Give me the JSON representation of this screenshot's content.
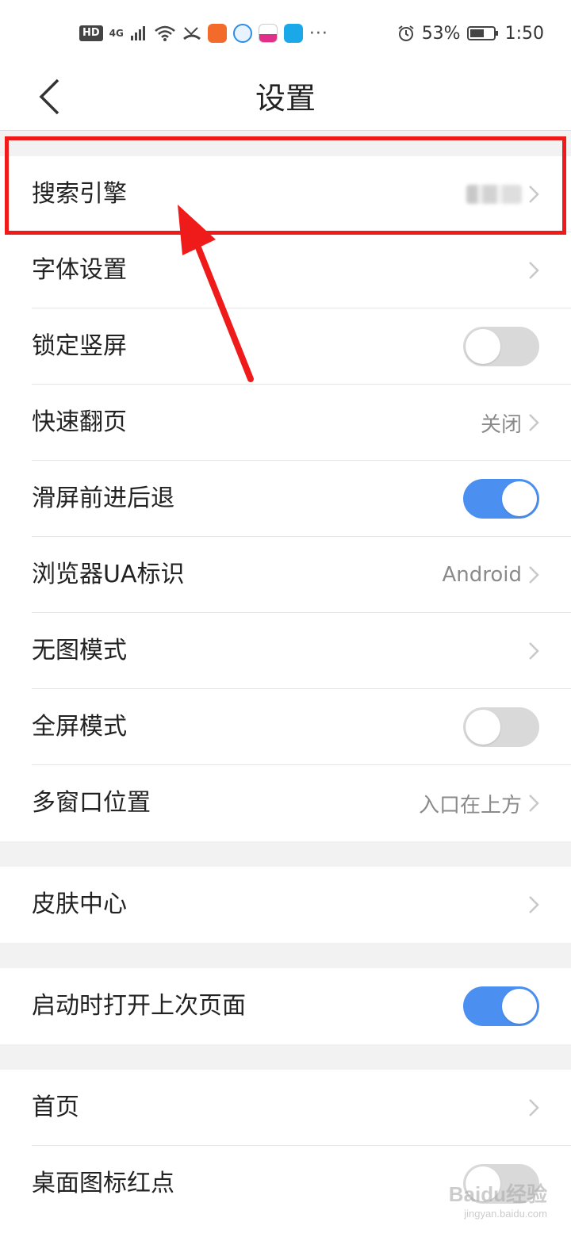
{
  "status_bar": {
    "hd": "HD",
    "network": "4G",
    "more": "···",
    "battery_pct": "53%",
    "time": "1:50"
  },
  "header": {
    "title": "设置"
  },
  "rows": [
    {
      "label": "搜索引擎",
      "value": "",
      "type": "nav-blurred"
    },
    {
      "label": "字体设置",
      "value": "",
      "type": "nav"
    },
    {
      "label": "锁定竖屏",
      "type": "toggle",
      "on": false
    },
    {
      "label": "快速翻页",
      "value": "关闭",
      "type": "nav"
    },
    {
      "label": "滑屏前进后退",
      "type": "toggle",
      "on": true
    },
    {
      "label": "浏览器UA标识",
      "value": "Android",
      "type": "nav"
    },
    {
      "label": "无图模式",
      "value": "",
      "type": "nav"
    },
    {
      "label": "全屏模式",
      "type": "toggle",
      "on": false
    },
    {
      "label": "多窗口位置",
      "value": "入口在上方",
      "type": "nav"
    },
    {
      "label": "皮肤中心",
      "value": "",
      "type": "nav"
    },
    {
      "label": "启动时打开上次页面",
      "type": "toggle",
      "on": true
    },
    {
      "label": "首页",
      "value": "",
      "type": "nav"
    },
    {
      "label": "桌面图标红点",
      "type": "toggle",
      "on": false
    }
  ],
  "watermark": {
    "main": "Baidu经验",
    "sub": "jingyan.baidu.com"
  },
  "colors": {
    "accent": "#4b90f0",
    "annotation": "#ef1b1b",
    "gap": "#f2f2f2"
  }
}
